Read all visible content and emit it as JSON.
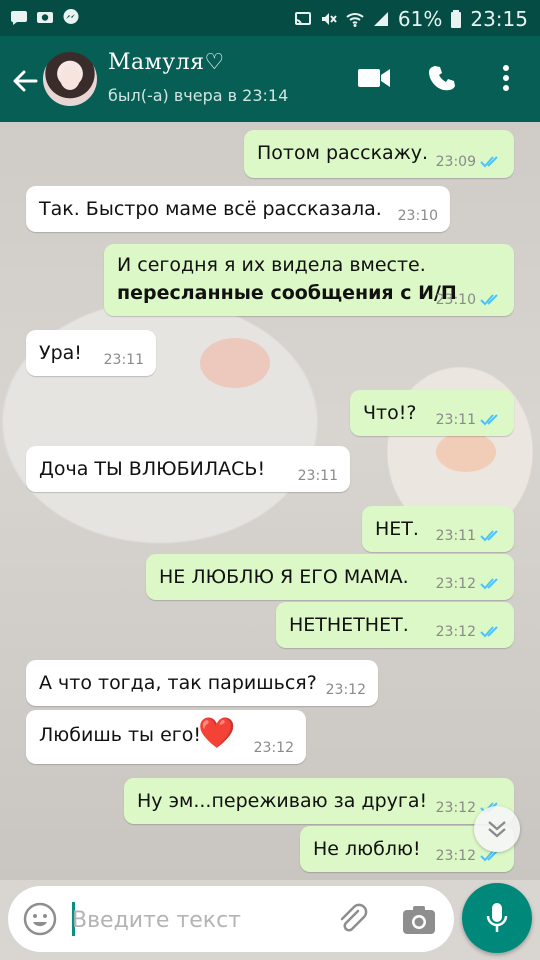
{
  "status_bar": {
    "battery": "61%",
    "time": "23:15",
    "icons": [
      "chat-notification-icon",
      "camera-notification-icon",
      "messenger-notification-icon",
      "cast-icon",
      "mute-icon",
      "wifi-icon",
      "signal-icon",
      "battery-icon"
    ]
  },
  "header": {
    "contact_name": "Мамуля♡",
    "status": "был(-а) вчера в 23:14",
    "icons": [
      "back-arrow-icon",
      "video-call-icon",
      "phone-icon",
      "more-options-icon"
    ]
  },
  "messages": [
    {
      "direction": "out",
      "text": "Потом расскажу.",
      "time": "23:09",
      "read": true
    },
    {
      "direction": "in",
      "text": "Так. Быстро маме всё рассказала.",
      "time": "23:10"
    },
    {
      "direction": "out",
      "lines": [
        "И сегодня я их видела вместе.",
        "пересланные сообщения с И/П"
      ],
      "time": "23:10",
      "read": true
    },
    {
      "direction": "in",
      "text": "Ура!",
      "time": "23:11"
    },
    {
      "direction": "out",
      "text": "Что!?",
      "time": "23:11",
      "read": true
    },
    {
      "direction": "in",
      "text": "Доча ТЫ ВЛЮБИЛАСЬ!",
      "time": "23:11"
    },
    {
      "direction": "out",
      "text": "НЕТ.",
      "time": "23:11",
      "read": true
    },
    {
      "direction": "out",
      "text": "НЕ ЛЮБЛЮ Я ЕГО МАМА.",
      "time": "23:12",
      "read": true
    },
    {
      "direction": "out",
      "text": "НЕТНЕТНЕТ.",
      "time": "23:12",
      "read": true
    },
    {
      "direction": "in",
      "text": "А что тогда, так паришься?",
      "time": "23:12"
    },
    {
      "direction": "in",
      "text": "Любишь ты его!",
      "emoji": "❤️",
      "time": "23:12"
    },
    {
      "direction": "out",
      "text": "Ну эм...переживаю за друга!",
      "time": "23:12",
      "read": true
    },
    {
      "direction": "out",
      "text": "Не люблю!",
      "time": "23:12",
      "read": true
    }
  ],
  "input": {
    "placeholder": "Введите текст",
    "value": ""
  },
  "colors": {
    "header": "#075e54",
    "status_bar": "#054c44",
    "outgoing_bubble": "#dcf8c6",
    "incoming_bubble": "#ffffff",
    "read_tick": "#4fc3f7",
    "fab": "#00897b"
  }
}
